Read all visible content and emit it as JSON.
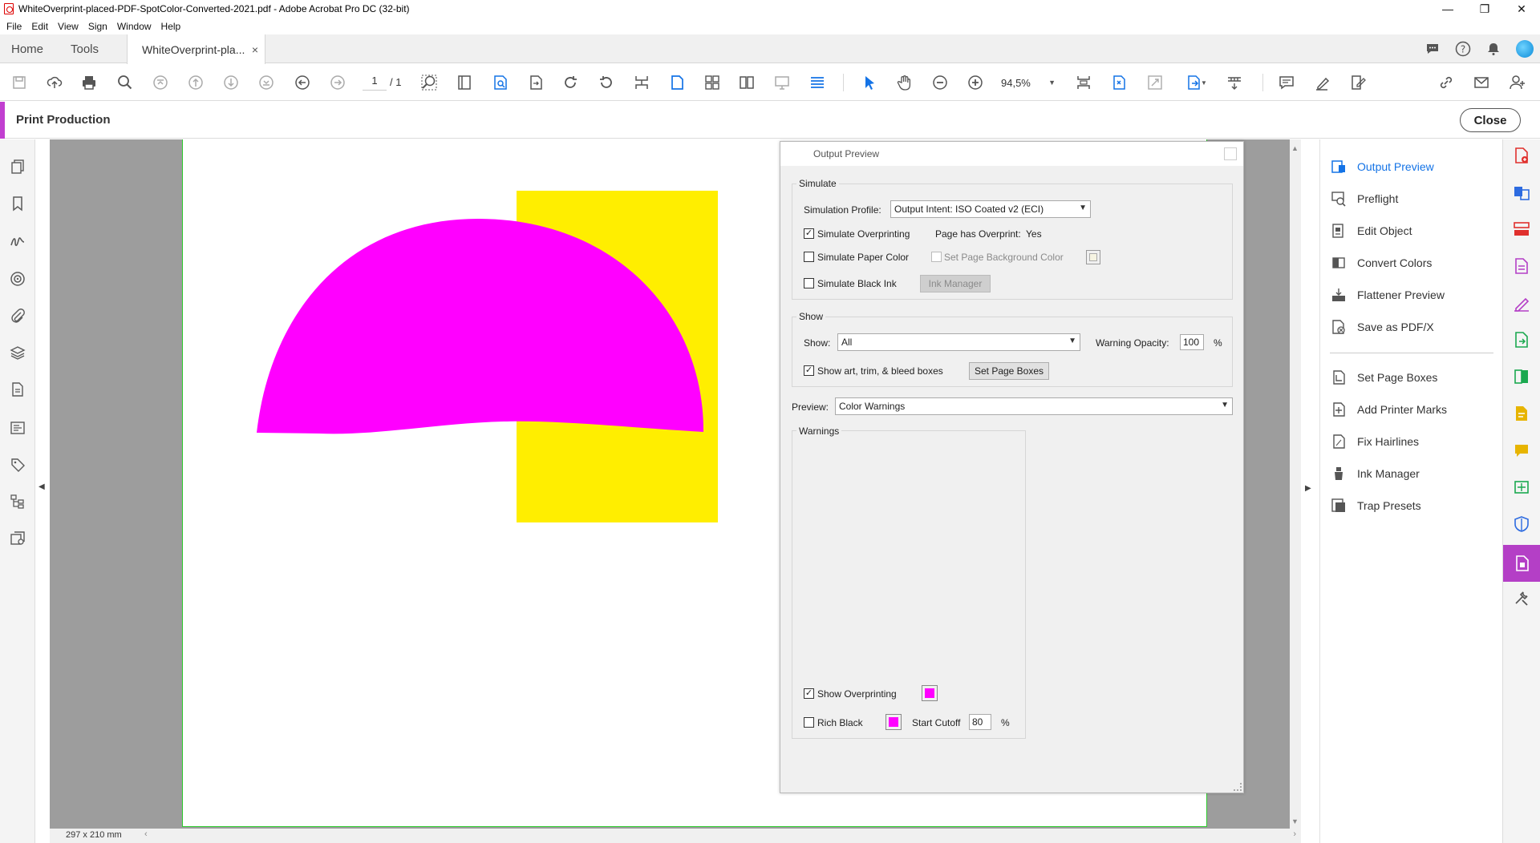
{
  "window": {
    "title": "WhiteOverprint-placed-PDF-SpotColor-Converted-2021.pdf - Adobe Acrobat Pro DC (32-bit)",
    "minimize": "—",
    "restore": "❐",
    "close": "✕"
  },
  "menu": [
    "File",
    "Edit",
    "View",
    "Sign",
    "Window",
    "Help"
  ],
  "tabs": {
    "home": "Home",
    "tools": "Tools",
    "document": "WhiteOverprint-pla...",
    "doc_close": "×"
  },
  "toolbar": {
    "page_current": "1",
    "page_total": "/ 1",
    "zoom": "94,5%"
  },
  "print_production": {
    "title": "Print Production",
    "close_label": "Close"
  },
  "status": {
    "page_size": "297 x 210 mm"
  },
  "output_preview": {
    "title": "Output Preview",
    "simulate": {
      "group_label": "Simulate",
      "profile_label": "Simulation Profile:",
      "profile_value": "Output Intent: ISO Coated v2 (ECI)",
      "simulate_overprinting_label": "Simulate Overprinting",
      "simulate_overprinting_checked": "✓",
      "page_has_overprint_label": "Page has Overprint:",
      "page_has_overprint_value": "Yes",
      "simulate_paper_color_label": "Simulate Paper Color",
      "set_page_background_label": "Set Page Background Color",
      "simulate_black_ink_label": "Simulate Black Ink",
      "ink_manager_label": "Ink Manager"
    },
    "show": {
      "group_label": "Show",
      "show_label": "Show:",
      "show_value": "All",
      "warning_opacity_label": "Warning Opacity:",
      "warning_opacity_value": "100",
      "percent": "%",
      "show_boxes_label": "Show art, trim, & bleed boxes",
      "show_boxes_checked": "✓",
      "set_page_boxes_label": "Set Page Boxes"
    },
    "preview_label": "Preview:",
    "preview_value": "Color Warnings",
    "warnings": {
      "group_label": "Warnings",
      "show_overprinting_label": "Show Overprinting",
      "show_overprinting_checked": "✓",
      "rich_black_label": "Rich Black",
      "start_cutoff_label": "Start Cutoff",
      "start_cutoff_value": "80",
      "percent": "%",
      "swatch_color": "#ff00ff"
    }
  },
  "right_panel": {
    "items_top": [
      {
        "label": "Output Preview",
        "icon": "output-preview-icon"
      },
      {
        "label": "Preflight",
        "icon": "preflight-icon"
      },
      {
        "label": "Edit Object",
        "icon": "edit-object-icon"
      },
      {
        "label": "Convert Colors",
        "icon": "convert-colors-icon"
      },
      {
        "label": "Flattener Preview",
        "icon": "flattener-preview-icon"
      },
      {
        "label": "Save as PDF/X",
        "icon": "save-pdfx-icon"
      }
    ],
    "items_bottom": [
      {
        "label": "Set Page Boxes",
        "icon": "set-page-boxes-icon"
      },
      {
        "label": "Add Printer Marks",
        "icon": "printer-marks-icon"
      },
      {
        "label": "Fix Hairlines",
        "icon": "fix-hairlines-icon"
      },
      {
        "label": "Ink Manager",
        "icon": "ink-manager-icon"
      },
      {
        "label": "Trap Presets",
        "icon": "trap-presets-icon"
      }
    ]
  },
  "colors": {
    "accent": "#1473e6",
    "print_production": "#b43fc6",
    "magenta": "#ff00ff",
    "yellow": "#ffee00"
  }
}
